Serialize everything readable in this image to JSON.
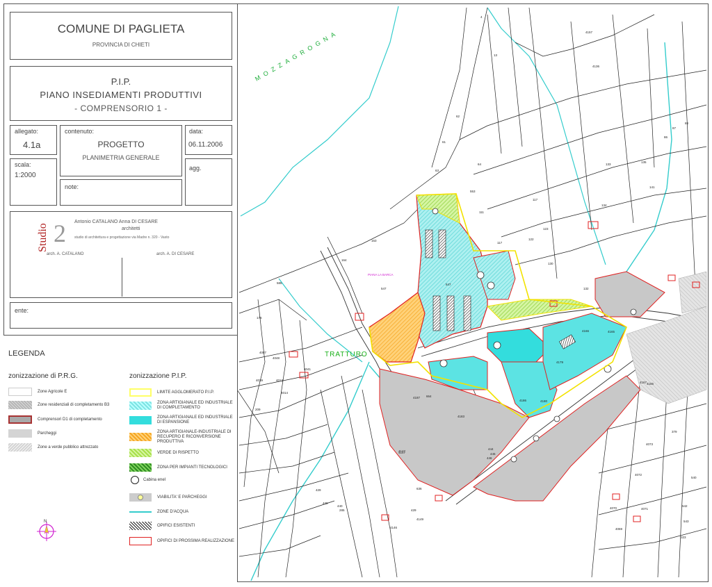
{
  "title_block": {
    "comune": "COMUNE DI PAGLIETA",
    "provincia": "PROVINCIA DI CHIETI",
    "pip": "P.I.P.",
    "piano": "PIANO INSEDIAMENTI PRODUTTIVI",
    "comprensorio": "- COMPRENSORIO 1 -",
    "allegato_label": "allegato:",
    "allegato_value": "4.1a",
    "contenuto_label": "contenuto:",
    "contenuto_title": "PROGETTO",
    "contenuto_sub": "PLANIMETRIA GENERALE",
    "data_label": "data:",
    "data_value": "06.11.2006",
    "scala_label": "scala:",
    "scala_value": "1:2000",
    "agg_label": "agg.",
    "note_label": "note:",
    "studio_word": "Studio",
    "studio_num": "2",
    "architects": "Antonio CATALANO    Anna DI CESARE",
    "architetti": "architetti",
    "studio_addr": "studio di architettura e progettazione via Madre n. 320 - Vasto",
    "sign_left": "arch. A. CATALANO",
    "sign_right": "arch. A. DI CESARE",
    "ente_label": "ente:"
  },
  "legend": {
    "title": "LEGENDA",
    "prg_title": "zonizzazione di P.R.G.",
    "pip_title": "zonizzazione P.I.P.",
    "prg_items": [
      {
        "label": "Zone Agricole E",
        "color": "#ffffff"
      },
      {
        "label": "Zone residenziali di completamento B3",
        "color": "#b8b8b8"
      },
      {
        "label": "Comprensori D1 di completamento",
        "color": "#a9a9a9"
      },
      {
        "label": "Parcheggi",
        "color": "#d4d4d4"
      },
      {
        "label": "Zone a verde pubblico attrezzato",
        "color": "#e2e2e2"
      }
    ],
    "pip_items": [
      {
        "label": "LIMITE AGGLOMERATO P.I.P.",
        "color": "#ffff66"
      },
      {
        "label": "ZONA ARTIGIANALE ED INDUSTRIALE DI COMPLETAMENTO",
        "color": "#7de3e3"
      },
      {
        "label": "ZONA ARTIGIANALE ED INDUSTRIALE DI ESPANSIONE",
        "color": "#33dddd"
      },
      {
        "label": "ZONA ARTIGIANALE-INDUSTRIALE DI RECUPERO E RICONVERSIONE PRODUTTIVA",
        "color": "#f5a623"
      },
      {
        "label": "VERDE DI RISPETTO",
        "color": "#a8e04a"
      },
      {
        "label": "ZONA PER IMPIANTI TECNOLOGICI",
        "color": "#4caf28"
      },
      {
        "label": "Cabina enel",
        "color": "#000000"
      },
      {
        "label": "VIABILITA' E PARCHEGGI",
        "color": "#cccccc"
      },
      {
        "label": "ZONE D'ACQUA",
        "color": "#33cccc"
      },
      {
        "label": "OPIFICI ESISTENTI",
        "color": "#333333"
      },
      {
        "label": "OPIFICI DI PROSSIMA REALIZZAZIONE",
        "color": "#e02020"
      }
    ]
  },
  "map": {
    "mozzagrogna": "MOZZAGROGNA",
    "tratturo": "TRATTURO",
    "piana": "PIANA LA BARCA",
    "parcel_numbers": [
      "547",
      "547",
      "163",
      "164",
      "585",
      "176",
      "4087",
      "4048",
      "4039",
      "4014",
      "4013",
      "4041",
      "209",
      "4147",
      "4146",
      "4157",
      "4136",
      "4166",
      "122",
      "117",
      "130",
      "132",
      "133",
      "134",
      "135",
      "141",
      "123",
      "111",
      "553",
      "64",
      "62",
      "61",
      "63",
      "4",
      "13",
      "117",
      "86",
      "87",
      "88",
      "4187",
      "4179",
      "4180",
      "444",
      "445",
      "446",
      "664",
      "4167",
      "4183",
      "4147",
      "429",
      "636",
      "4149",
      "285",
      "440",
      "430",
      "429",
      "4072",
      "4070",
      "4071",
      "4069",
      "4073",
      "540",
      "543",
      "542",
      "379",
      "323",
      "4186",
      "4166",
      "4165"
    ],
    "compass_label": "N"
  },
  "colors": {
    "cyan_zone": "#7fe6e6",
    "orange_zone": "#f5a623",
    "grey_zone": "#c8c8c8",
    "green_zone": "#8fd13f",
    "red_outline": "#e02020",
    "yellow_outline": "#f2e200",
    "water": "#33cccc"
  }
}
